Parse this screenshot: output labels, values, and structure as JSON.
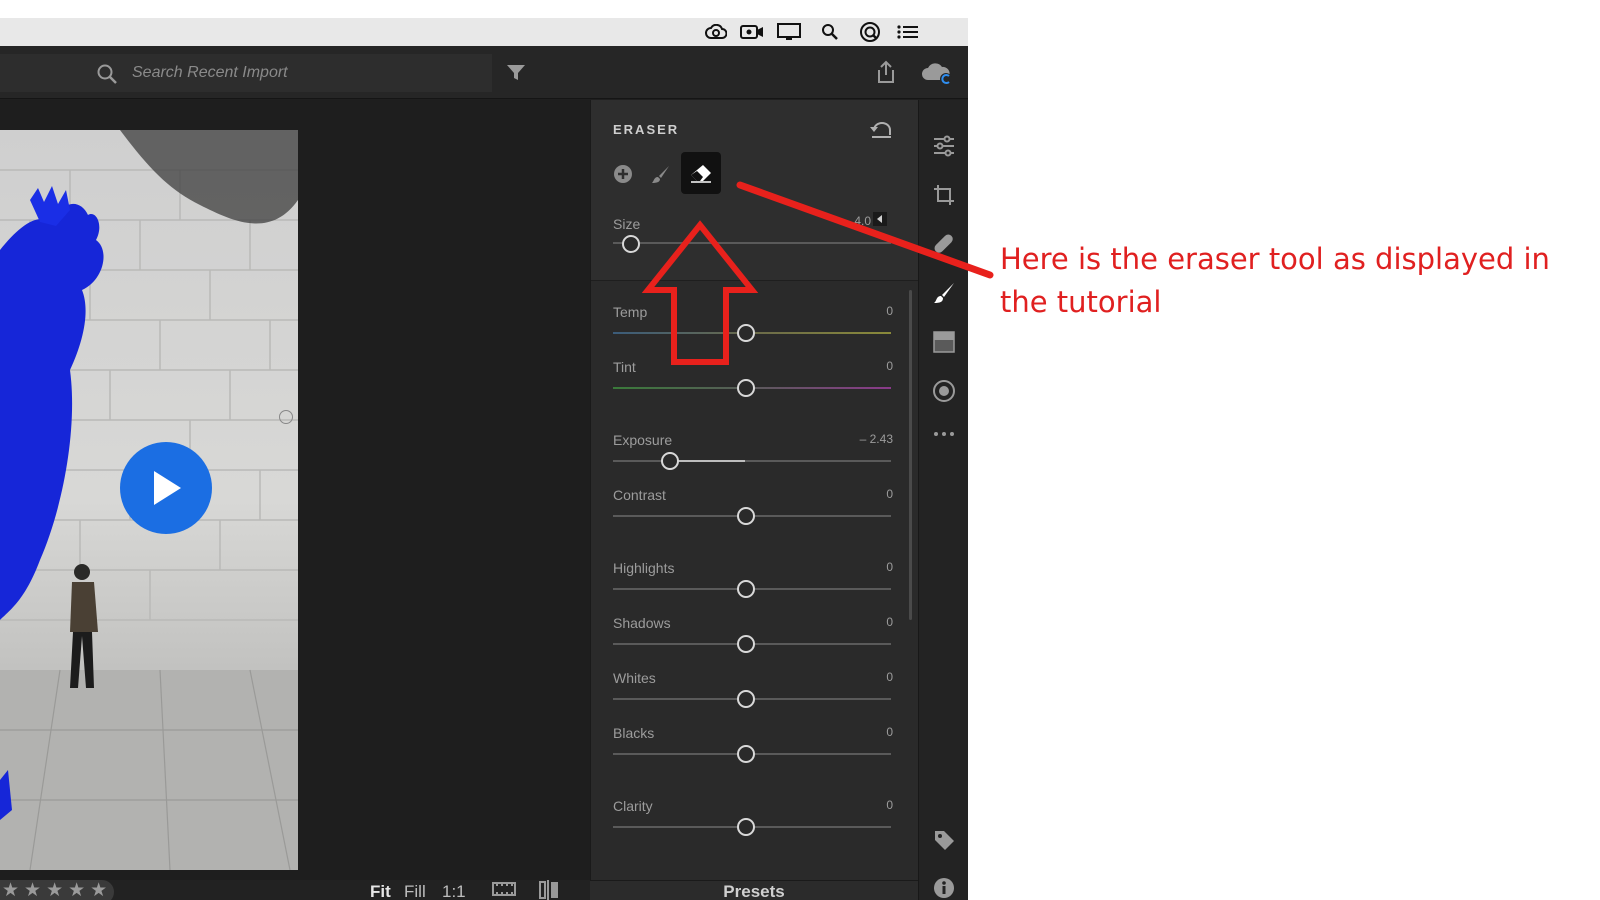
{
  "menubar": {
    "icons": [
      "creative-cloud-icon",
      "screen-record-icon",
      "display-icon",
      "spotlight-search-icon",
      "accessibility-icon",
      "list-menu-icon"
    ]
  },
  "toolbar": {
    "search_placeholder": "Search Recent Import"
  },
  "panel": {
    "title": "ERASER",
    "size": {
      "label": "Size",
      "value": "4.0"
    },
    "sliders": [
      {
        "label": "Temp",
        "value": "0"
      },
      {
        "label": "Tint",
        "value": "0"
      },
      {
        "label": "Exposure",
        "value": "– 2.43"
      },
      {
        "label": "Contrast",
        "value": "0"
      },
      {
        "label": "Highlights",
        "value": "0"
      },
      {
        "label": "Shadows",
        "value": "0"
      },
      {
        "label": "Whites",
        "value": "0"
      },
      {
        "label": "Blacks",
        "value": "0"
      },
      {
        "label": "Clarity",
        "value": "0"
      }
    ]
  },
  "bottombar": {
    "stars": "★★★★★",
    "fit": "Fit",
    "fill": "Fill",
    "one_to_one": "1:1"
  },
  "presets_label": "Presets",
  "annotation": "Here is the eraser tool as displayed in the tutorial",
  "colors": {
    "annotation": "#e02020",
    "play": "#1b6ee3",
    "rooster": "#1626d8",
    "panel": "#2a2a2a"
  }
}
